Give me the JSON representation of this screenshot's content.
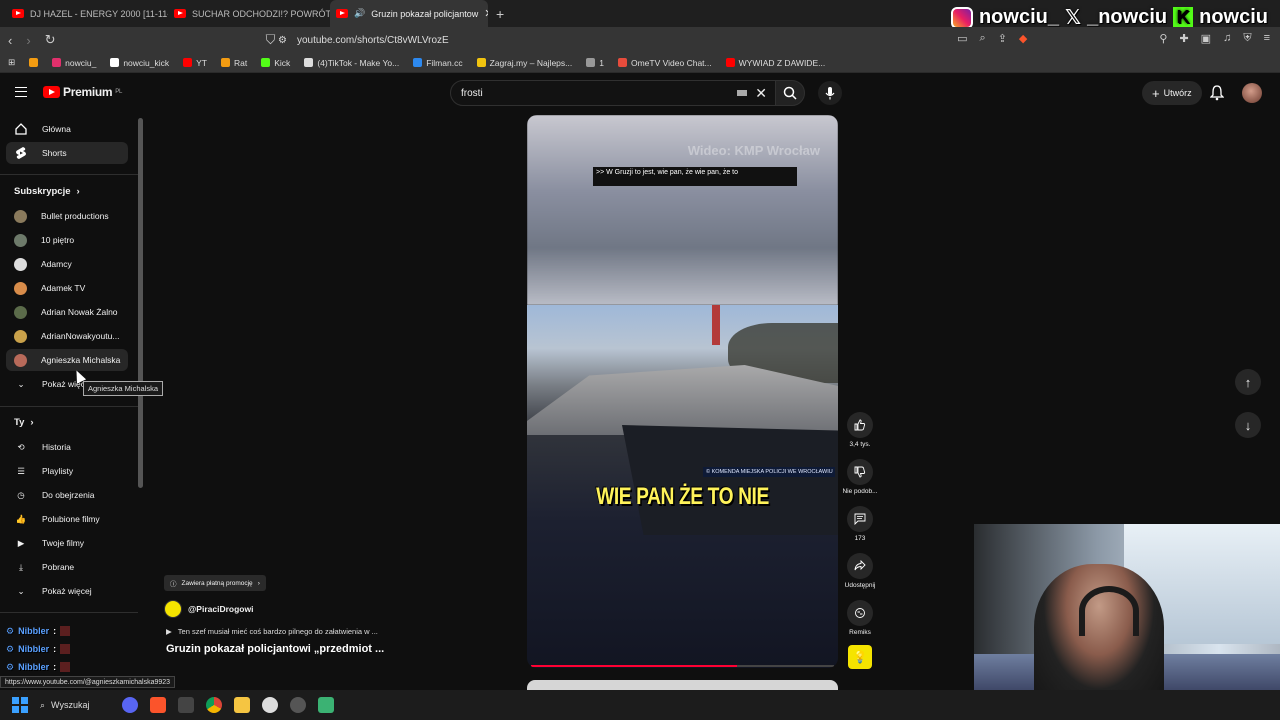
{
  "browser": {
    "tabs": [
      {
        "label": "DJ HAZEL - ENERGY 2000 [11-11-"
      },
      {
        "label": "SUCHAR ODCHODZI!? POWRÓT BRU"
      },
      {
        "label": "Gruzin pokazał policjantow"
      }
    ],
    "url": "youtube.com/shorts/Ct8vWLVrozE",
    "bookmarks": [
      {
        "label": "nowciu_",
        "color": "#e1306c"
      },
      {
        "label": "nowciu_kick",
        "color": "#ffffff"
      },
      {
        "label": "YT",
        "color": "#ff0000"
      },
      {
        "label": "Rat",
        "color": "#f39c12"
      },
      {
        "label": "Kick",
        "color": "#53fc18"
      },
      {
        "label": "(4)TikTok - Make Yo...",
        "color": "#ffffff"
      },
      {
        "label": "Filman.cc",
        "color": "#2d89ef"
      },
      {
        "label": "Zagraj.my – Najleps...",
        "color": "#f1c40f"
      },
      {
        "label": "1",
        "color": "#999999"
      },
      {
        "label": "OmeTV Video Chat...",
        "color": "#e74c3c"
      },
      {
        "label": "WYWIAD Z DAWIDE...",
        "color": "#ff0000"
      }
    ]
  },
  "stream_overlay": {
    "instagram": "nowciu_",
    "x": "_nowciu",
    "kick": "nowciu"
  },
  "youtube": {
    "logo_text": "Premium",
    "logo_region": "PL",
    "search_value": "frosti",
    "create_label": "Utwórz",
    "accent": "#ff0000"
  },
  "sidebar": {
    "main": [
      {
        "label": "Główna",
        "icon": "home-icon"
      },
      {
        "label": "Shorts",
        "icon": "shorts-icon"
      }
    ],
    "subscriptions_header": "Subskrypcje",
    "subscriptions": [
      {
        "label": "Bullet productions",
        "color": "#8a7a5c"
      },
      {
        "label": "10 piętro",
        "color": "#6d7a6a"
      },
      {
        "label": "Adamcy",
        "color": "#dddddd"
      },
      {
        "label": "Adamek TV",
        "color": "#d88c4a"
      },
      {
        "label": "Adrian Nowak Żalno",
        "color": "#5b6b4a"
      },
      {
        "label": "AdrianNowakyoutu...",
        "color": "#c9a14a"
      },
      {
        "label": "Agnieszka Michalska",
        "color": "#b86a5a"
      }
    ],
    "show_more_subs": "Pokaż więcej",
    "you_header": "Ty",
    "you": [
      {
        "label": "Historia",
        "icon": "history-icon"
      },
      {
        "label": "Playlisty",
        "icon": "playlist-icon"
      },
      {
        "label": "Do obejrzenia",
        "icon": "watch-later-icon"
      },
      {
        "label": "Polubione filmy",
        "icon": "like-icon"
      },
      {
        "label": "Twoje filmy",
        "icon": "your-videos-icon"
      },
      {
        "label": "Pobrane",
        "icon": "download-icon"
      },
      {
        "label": "Pokaż więcej",
        "icon": "chevron-down-icon"
      }
    ],
    "tooltip": "Agnieszka Michalska"
  },
  "short": {
    "watermark": "Wideo: KMP Wrocław",
    "caption": ">> W Gruzji to jest, wie pan, że wie pan, że to",
    "police_tag": "© KOMENDA MIEJSKA POLICJI WE WROCŁAWIU",
    "subtitle": "WIE PAN ŻE TO NIE",
    "progress": 0.68,
    "likes": "3,4 tys.",
    "dislike_label": "Nie podob...",
    "comments": "173",
    "share_label": "Udostępnij",
    "remix_label": "Remiks",
    "promo_label": "Zawiera płatną promocję",
    "channel": "@PiraciDrogowi",
    "description": "Ten szef musiał mieć coś bardzo pilnego do załatwienia w ...",
    "title": "Gruzin pokazał policjantowi „przedmiot ..."
  },
  "chat": [
    {
      "user": "Nibbler",
      "msg": ": "
    },
    {
      "user": "Nibbler",
      "msg": ": "
    },
    {
      "user": "Nibbler",
      "msg": ": "
    },
    {
      "user": "Nibbler",
      "msg": ": "
    }
  ],
  "status_url": "https://www.youtube.com/@agnieszkamichalska9923",
  "taskbar": {
    "search_label": "Wyszukaj"
  }
}
